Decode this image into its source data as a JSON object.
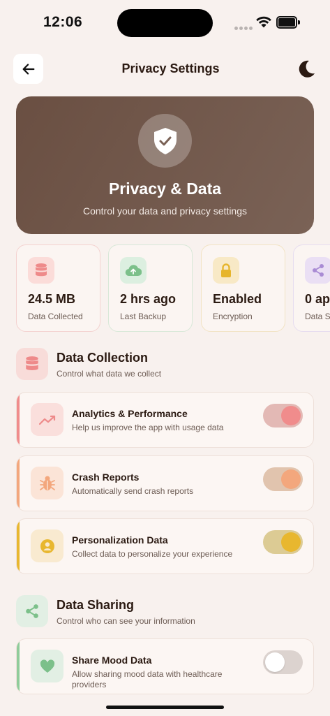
{
  "status_bar": {
    "time": "12:06"
  },
  "header": {
    "title": "Privacy Settings"
  },
  "hero": {
    "title": "Privacy & Data",
    "subtitle": "Control your data and privacy settings"
  },
  "stats": [
    {
      "value": "24.5 MB",
      "label": "Data Collected",
      "icon": "database-icon"
    },
    {
      "value": "2 hrs ago",
      "label": "Last Backup",
      "icon": "cloud-upload-icon"
    },
    {
      "value": "Enabled",
      "label": "Encryption",
      "icon": "lock-icon"
    },
    {
      "value": "0 ap",
      "label": "Data S",
      "icon": "share-icon"
    }
  ],
  "sections": {
    "collection": {
      "title": "Data Collection",
      "subtitle": "Control what data we collect"
    },
    "sharing": {
      "title": "Data Sharing",
      "subtitle": "Control who can see your information"
    }
  },
  "settings": [
    {
      "title": "Analytics & Performance",
      "description": "Help us improve the app with usage data",
      "enabled": true,
      "accent": "#f08c8c"
    },
    {
      "title": "Crash Reports",
      "description": "Automatically send crash reports",
      "enabled": true,
      "accent": "#f3a77d"
    },
    {
      "title": "Personalization Data",
      "description": "Collect data to personalize your experience",
      "enabled": true,
      "accent": "#e8b72f"
    },
    {
      "title": "Share Mood Data",
      "description": "Allow sharing mood data with healthcare providers",
      "enabled": false,
      "accent": "#8fcc9a"
    }
  ]
}
